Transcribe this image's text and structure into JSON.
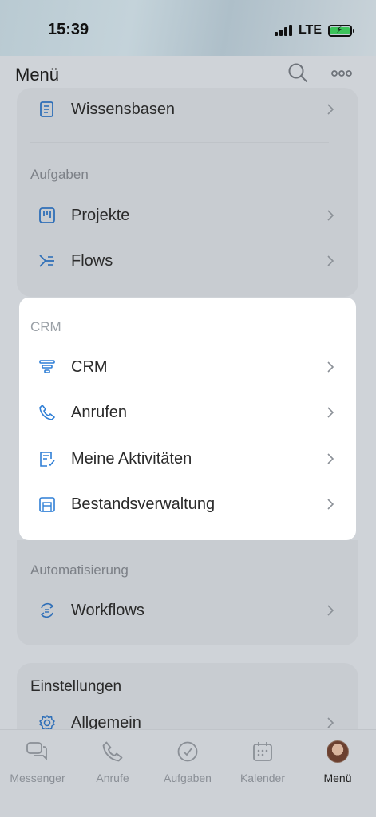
{
  "status": {
    "time": "15:39",
    "network": "LTE"
  },
  "header": {
    "title": "Menü"
  },
  "groups": {
    "top": {
      "items": [
        {
          "label": "Wissensbasen"
        }
      ]
    },
    "aufgaben": {
      "title": "Aufgaben",
      "items": [
        {
          "label": "Projekte"
        },
        {
          "label": "Flows"
        }
      ]
    },
    "crm": {
      "title": "CRM",
      "items": [
        {
          "label": "CRM"
        },
        {
          "label": "Anrufen"
        },
        {
          "label": "Meine Aktivitäten"
        },
        {
          "label": "Bestandsverwaltung"
        }
      ]
    },
    "automatisierung": {
      "title": "Automatisierung",
      "items": [
        {
          "label": "Workflows"
        }
      ]
    },
    "einstellungen": {
      "title": "Einstellungen",
      "items": [
        {
          "label": "Allgemein"
        }
      ]
    }
  },
  "tabs": [
    {
      "label": "Messenger",
      "icon": "messenger-icon"
    },
    {
      "label": "Anrufe",
      "icon": "phone-icon"
    },
    {
      "label": "Aufgaben",
      "icon": "check-circle-icon"
    },
    {
      "label": "Kalender",
      "icon": "calendar-icon"
    },
    {
      "label": "Menü",
      "icon": "avatar",
      "active": true
    }
  ],
  "colors": {
    "accent": "#2f7fd6",
    "highlight_bg": "#ffffff",
    "dim_bg": "#cfd3d8"
  }
}
